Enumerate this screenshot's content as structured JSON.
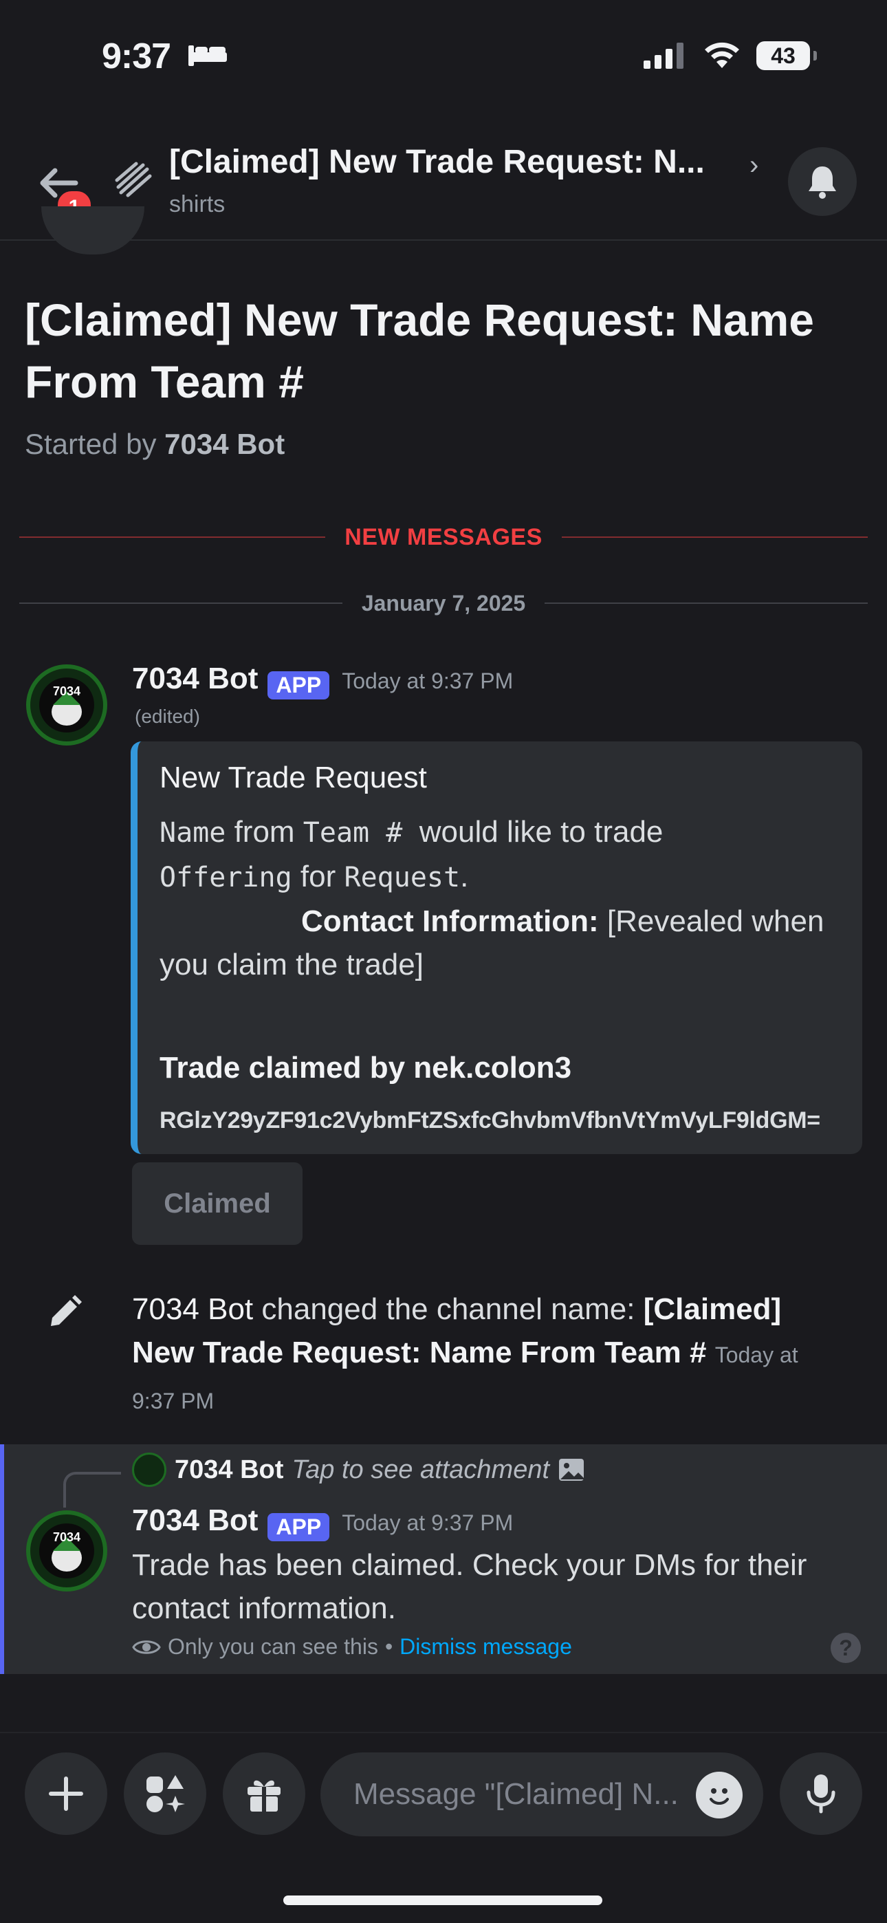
{
  "status_bar": {
    "time": "9:37",
    "battery": "43"
  },
  "header": {
    "back_badge": "1",
    "title": "[Claimed] New Trade Request: N...",
    "subtitle": "shirts"
  },
  "thread": {
    "title": "[Claimed] New Trade Request: Name From Team #",
    "started_by_prefix": "Started by",
    "started_by_name": "7034 Bot"
  },
  "dividers": {
    "new_messages": "NEW MESSAGES",
    "date": "January 7, 2025"
  },
  "message1": {
    "author": "7034 Bot",
    "tag": "APP",
    "time": "Today at 9:37 PM",
    "edited": "(edited)",
    "embed": {
      "title": "New Trade Request",
      "name_code": "Name",
      "from_text": "from",
      "team_code": "Team #",
      "would_like": "would like to trade",
      "offering_code": "Offering",
      "for_text": "for",
      "request_code": "Request",
      "period": ".",
      "contact_label": "Contact Information:",
      "contact_value": "[Revealed when you claim the trade]",
      "claimed_by": "Trade claimed by nek.colon3",
      "code": "RGlzY29yZF91c2VybmFtZSxfcGhvbmVfbnVtYmVyLF9ldGM="
    },
    "button": "Claimed"
  },
  "system_message": {
    "author": "7034 Bot",
    "action": "changed the channel name:",
    "new_name": "[Claimed] New Trade Request: Name From Team #",
    "time": "Today at 9:37 PM"
  },
  "ephemeral": {
    "reply_author": "7034 Bot",
    "reply_text": "Tap to see attachment",
    "author": "7034 Bot",
    "tag": "APP",
    "time": "Today at 9:37 PM",
    "text": "Trade has been claimed. Check your DMs for their contact information.",
    "note": "Only you can see this",
    "bullet": "•",
    "dismiss": "Dismiss message",
    "help": "?"
  },
  "composer": {
    "placeholder": "Message \"[Claimed] N..."
  },
  "colors": {
    "accent": "#5865f2",
    "new_messages": "#f23f42",
    "embed_bar": "#3498db",
    "link": "#00a8fc",
    "avatar_green": "#1d6b22"
  },
  "icons": [
    "bed-icon",
    "signal-icon",
    "wifi-icon",
    "battery-icon",
    "back-arrow-icon",
    "thread-icon",
    "chevron-right-icon",
    "bell-icon",
    "pencil-icon",
    "image-icon",
    "eye-icon",
    "help-icon",
    "plus-icon",
    "apps-icon",
    "gift-icon",
    "emoji-icon",
    "microphone-icon"
  ]
}
